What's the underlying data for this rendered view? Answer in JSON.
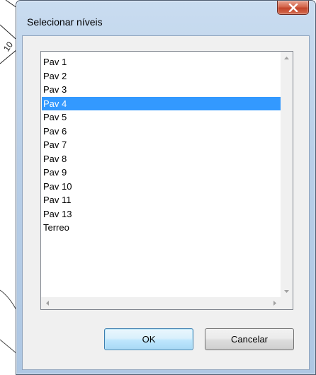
{
  "window": {
    "title": "Selecionar níveis"
  },
  "listbox": {
    "items": [
      "Pav 1",
      "Pav 2",
      "Pav 3",
      "Pav 4",
      "Pav 5",
      "Pav 6",
      "Pav 7",
      "Pav 8",
      "Pav 9",
      "Pav 10",
      "Pav 11",
      "Pav 13",
      "Terreo"
    ],
    "selected": "Pav 4"
  },
  "buttons": {
    "ok_label": "OK",
    "cancel_label": "Cancelar"
  },
  "background": {
    "drawing_text": "10"
  },
  "colors": {
    "selection": "#3399ff",
    "close_button": "#c3452b",
    "frame": "#b9cfe8"
  },
  "icons": {
    "close": "close-icon",
    "scroll_up": "scroll-up-arrow-icon",
    "scroll_down": "scroll-down-arrow-icon",
    "scroll_left": "scroll-left-arrow-icon",
    "scroll_right": "scroll-right-arrow-icon"
  }
}
